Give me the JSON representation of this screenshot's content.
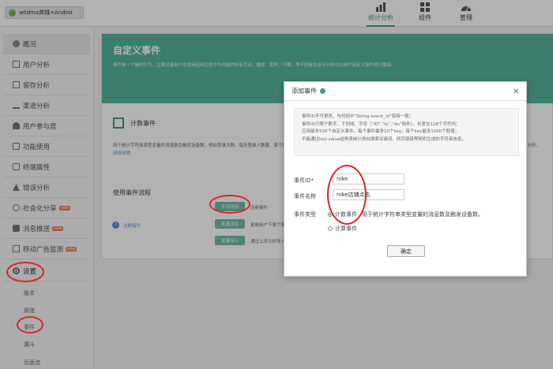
{
  "topbar": {
    "app_name": "wildma商城+Androi",
    "nav": [
      {
        "label": "统计分析",
        "icon": "bar-chart-icon",
        "active": true
      },
      {
        "label": "组件",
        "icon": "grid-icon",
        "active": false
      },
      {
        "label": "管理",
        "icon": "dashboard-icon",
        "active": false
      }
    ]
  },
  "sidebar": {
    "items": [
      {
        "label": "概况",
        "icon": "overview-icon"
      },
      {
        "label": "用户分析",
        "icon": "user-chart-icon"
      },
      {
        "label": "留存分析",
        "icon": "retention-icon"
      },
      {
        "label": "渠道分析",
        "icon": "channel-icon"
      },
      {
        "label": "用户参与度",
        "icon": "engagement-icon"
      },
      {
        "label": "功能使用",
        "icon": "function-icon"
      },
      {
        "label": "终端属性",
        "icon": "device-icon"
      },
      {
        "label": "错误分析",
        "icon": "error-icon"
      },
      {
        "label": "社会化分享",
        "icon": "share-icon",
        "badge": "new"
      },
      {
        "label": "消息推送",
        "icon": "push-icon",
        "badge": "new"
      },
      {
        "label": "移动广告监测",
        "icon": "ad-monitor-icon",
        "badge": "new"
      },
      {
        "label": "设置",
        "icon": "settings-icon"
      }
    ],
    "sub_items": [
      "版本",
      "渠道",
      "事件",
      "漏斗",
      "页面流"
    ]
  },
  "main": {
    "title": "自定义事件",
    "description": "事件是一个操作行为，主要记录用户在使用应用过程中与内容的所有互动，播放、暂停、下载、等不同是在会计分析中以用户自定义事件进行跟踪。",
    "count_section": {
      "title": "计数事件",
      "description": "用于统计字符串类型变量的消息数及触发设备数，例如登录次数、每天登录人数量、某个按钮的点击次数、",
      "link": "详细说明",
      "edge_text": "及分析、"
    },
    "flow": {
      "title": "使用事件流程",
      "steps": [
        {
          "button": "手动添加",
          "text": "注册事件"
        },
        {
          "button": "批量添加",
          "text": "复制用户下某个事件"
        },
        {
          "button": "批量导入",
          "text": "通过上传文件导入事件"
        }
      ],
      "help": "注册指引"
    }
  },
  "dialog": {
    "title": "添加事件",
    "close": "×",
    "notes": [
      "事件ID不可更改，与代码中“String event_id”保持一致；",
      "事件ID只限于数字、下划线、字母（“ID”,“ts”,“du”除外），长度在128个字符内；",
      "应用最多500个自定义事件，每个事件最多10个key，每个key最多1000个取值；",
      "不能通过key-value结构来统计类似搜索关键词、网页链接等随机生成的字符串信息。"
    ],
    "fields": {
      "event_id_label": "事件ID*",
      "event_id_value": "nike",
      "event_name_label": "事件名称",
      "event_name_value": "nike店铺点击",
      "event_type_label": "事件类型",
      "options": [
        {
          "label": "计数事件",
          "desc": "用于统计字符串类型变量的消息数及触发设备数。",
          "selected": true
        },
        {
          "label": "计算事件",
          "desc": "",
          "selected": false
        }
      ]
    },
    "confirm": "确定"
  },
  "colors": {
    "accent": "#3e9c85",
    "hero": "#56b59e",
    "annotation": "#d9252a"
  }
}
